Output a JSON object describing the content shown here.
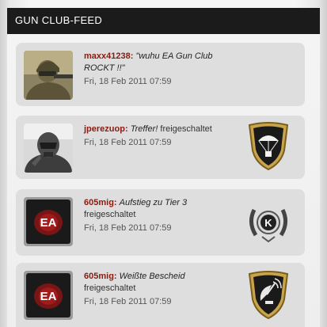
{
  "header": {
    "title": "GUN CLUB-FEED"
  },
  "feed": [
    {
      "user": "maxx41238:",
      "message": "\"wuhu EA Gun Club ROCKT !!\"",
      "suffix": "",
      "date": "Fri, 18 Feb 2011 07:59",
      "avatar_icon": "soldier-avatar-icon",
      "badge_icon": ""
    },
    {
      "user": "jperezuop:",
      "message": "Treffer!",
      "suffix": "freigeschaltet",
      "date": "Fri, 18 Feb 2011 07:59",
      "avatar_icon": "nanosuit-avatar-icon",
      "badge_icon": "parachute-badge-icon"
    },
    {
      "user": "605mig:",
      "message": "Aufstieg zu Tier 3",
      "suffix": "freigeschaltet",
      "date": "Fri, 18 Feb 2011 07:59",
      "avatar_icon": "ea-logo-avatar-icon",
      "badge_icon": "tier-wreath-badge-icon"
    },
    {
      "user": "605mig:",
      "message": "Weißte Bescheid",
      "suffix": "freigeschaltet",
      "date": "Fri, 18 Feb 2011 07:59",
      "avatar_icon": "ea-logo-avatar-icon",
      "badge_icon": "radar-badge-icon"
    }
  ],
  "colors": {
    "username": "#8b1a0f",
    "header_bg": "#1b1b1b",
    "card_bg": "#dedede"
  }
}
